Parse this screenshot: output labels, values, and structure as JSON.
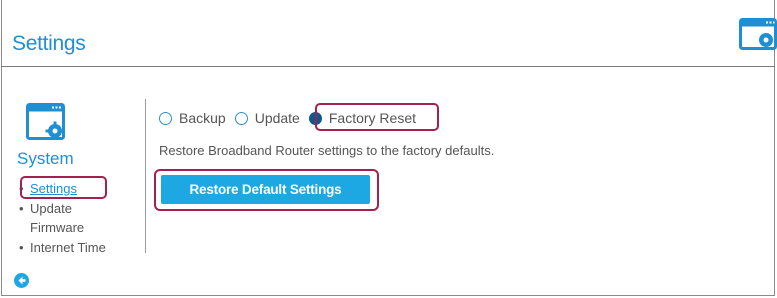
{
  "header": {
    "title": "Settings",
    "icon": "settings-window-icon"
  },
  "sidebar": {
    "section_icon": "system-settings-icon",
    "section_label": "System",
    "items": [
      {
        "label": "Settings",
        "active": true
      },
      {
        "label": "Update"
      },
      {
        "label": "Firmware"
      },
      {
        "label": "Internet Time"
      }
    ],
    "back_icon": "back-arrow-icon"
  },
  "main": {
    "radio_options": [
      {
        "label": "Backup",
        "checked": false
      },
      {
        "label": "Update",
        "checked": false
      },
      {
        "label": "Factory Reset",
        "checked": true
      }
    ],
    "description": "Restore Broadband Router settings to the factory defaults.",
    "restore_button_label": "Restore Default Settings"
  },
  "colors": {
    "accent": "#1f8fd3",
    "button": "#1da7e3",
    "highlight": "#a3214e",
    "radio_checked": "#0a5a91"
  }
}
